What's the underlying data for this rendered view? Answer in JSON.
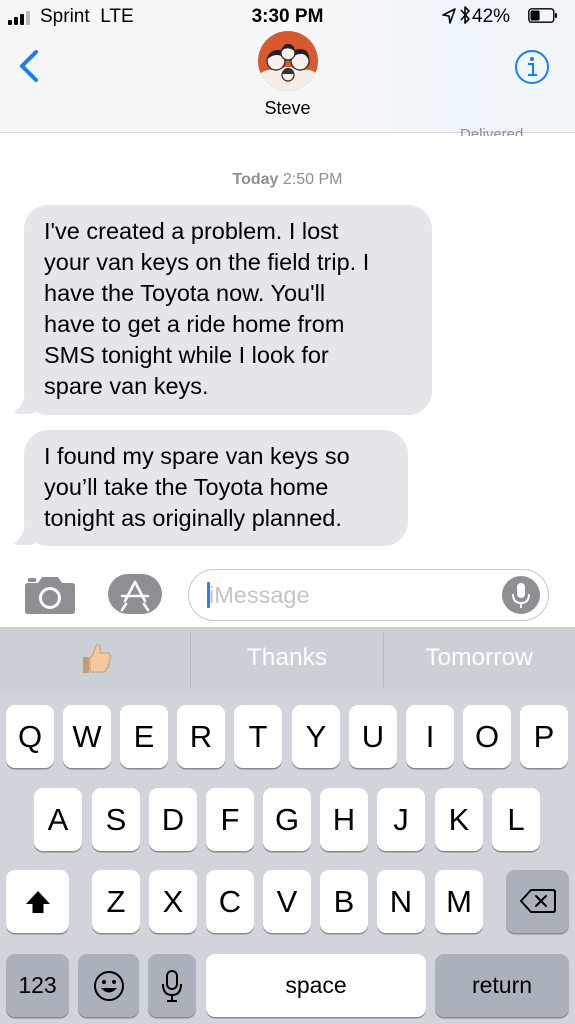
{
  "status_bar": {
    "carrier": "Sprint",
    "network": "LTE",
    "time": "3:30 PM",
    "battery_percent": "42%",
    "battery_level": 0.42,
    "icons": [
      "signal-bars-icon",
      "location-arrow-icon",
      "bluetooth-icon",
      "battery-icon"
    ]
  },
  "header": {
    "contact_name": "Steve",
    "back_icon": "chevron-left-icon",
    "info_icon": "info-icon",
    "accent_color": "#1a7cf6"
  },
  "thread": {
    "delivered_label": "Delivered",
    "timestamp_day": "Today",
    "timestamp_time": "2:50 PM",
    "messages": [
      {
        "direction": "incoming",
        "lines": [
          "I've created a problem. I lost",
          "your van keys on the field trip. I",
          "have the Toyota now. You'll",
          "have to get a ride home from",
          "SMS tonight while I look for",
          "spare van keys."
        ]
      },
      {
        "direction": "incoming",
        "lines": [
          "I found my spare van keys so",
          "you’ll take the Toyota home",
          "tonight as originally planned."
        ]
      }
    ],
    "bubble_color": "#e5e5ea"
  },
  "compose": {
    "placeholder": "iMessage",
    "camera_icon": "camera-icon",
    "apps_icon": "app-store-icon",
    "dictation_icon": "microphone-icon"
  },
  "keyboard": {
    "suggestions": {
      "emoji_icon": "thumbs-up-emoji-icon",
      "thanks": "Thanks",
      "tomorrow": "Tomorrow"
    },
    "row1": [
      "Q",
      "W",
      "E",
      "R",
      "T",
      "Y",
      "U",
      "I",
      "O",
      "P"
    ],
    "row2": [
      "A",
      "S",
      "D",
      "F",
      "G",
      "H",
      "J",
      "K",
      "L"
    ],
    "row3": [
      "Z",
      "X",
      "C",
      "V",
      "B",
      "N",
      "M"
    ],
    "shift_icon": "shift-arrow-icon",
    "delete_icon": "backspace-icon",
    "numbers_label": "123",
    "emoji_key_icon": "smiley-face-icon",
    "mic_icon": "microphone-icon",
    "space_label": "space",
    "return_label": "return"
  }
}
